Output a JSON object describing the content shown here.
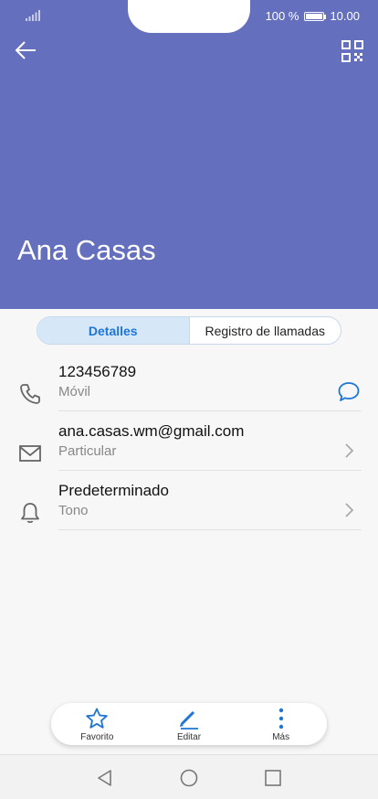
{
  "status": {
    "battery": "100 %",
    "time": "10.00"
  },
  "contact": {
    "name": "Ana Casas"
  },
  "tabs": [
    {
      "label": "Detalles"
    },
    {
      "label": "Registro de llamadas"
    }
  ],
  "entries": [
    {
      "main": "123456789",
      "sub": "Móvil",
      "icon": "phone-icon"
    },
    {
      "main": "ana.casas.wm@gmail.com",
      "sub": "Particular",
      "icon": "mail-icon"
    },
    {
      "main": "Predeterminado",
      "sub": "Tono",
      "icon": "bell-icon"
    }
  ],
  "bottom_actions": [
    {
      "label": "Favorito",
      "icon": "star-icon"
    },
    {
      "label": "Editar",
      "icon": "pencil-icon"
    },
    {
      "label": "Más",
      "icon": "more-vertical-icon"
    }
  ],
  "colors": {
    "header": "#6470bd",
    "accent": "#1e76d4"
  }
}
